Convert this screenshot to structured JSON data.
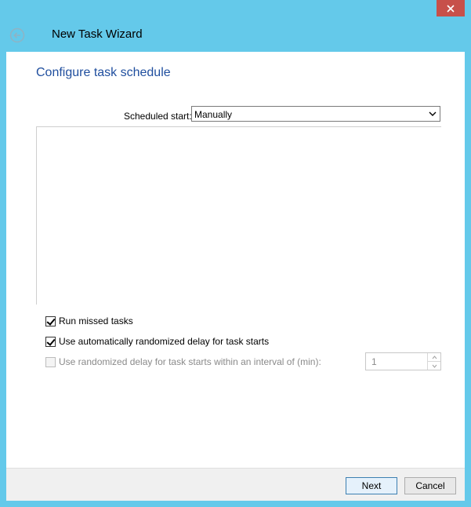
{
  "window": {
    "title": "New Task Wizard",
    "close_icon": "close-icon",
    "back_icon": "back-arrow-icon",
    "accent": "#64c9ea"
  },
  "page": {
    "heading": "Configure task schedule",
    "scheduled_start_label": "Scheduled start:",
    "scheduled_start_value": "Manually"
  },
  "options": {
    "run_missed": {
      "label": "Run missed tasks",
      "checked": true
    },
    "auto_random_delay": {
      "label": "Use automatically randomized delay for task starts",
      "checked": true
    },
    "random_delay_interval": {
      "label": "Use randomized delay for task starts within an interval of (min):",
      "checked": false,
      "enabled": false,
      "value": "1"
    }
  },
  "footer": {
    "next_label": "Next",
    "cancel_label": "Cancel"
  }
}
